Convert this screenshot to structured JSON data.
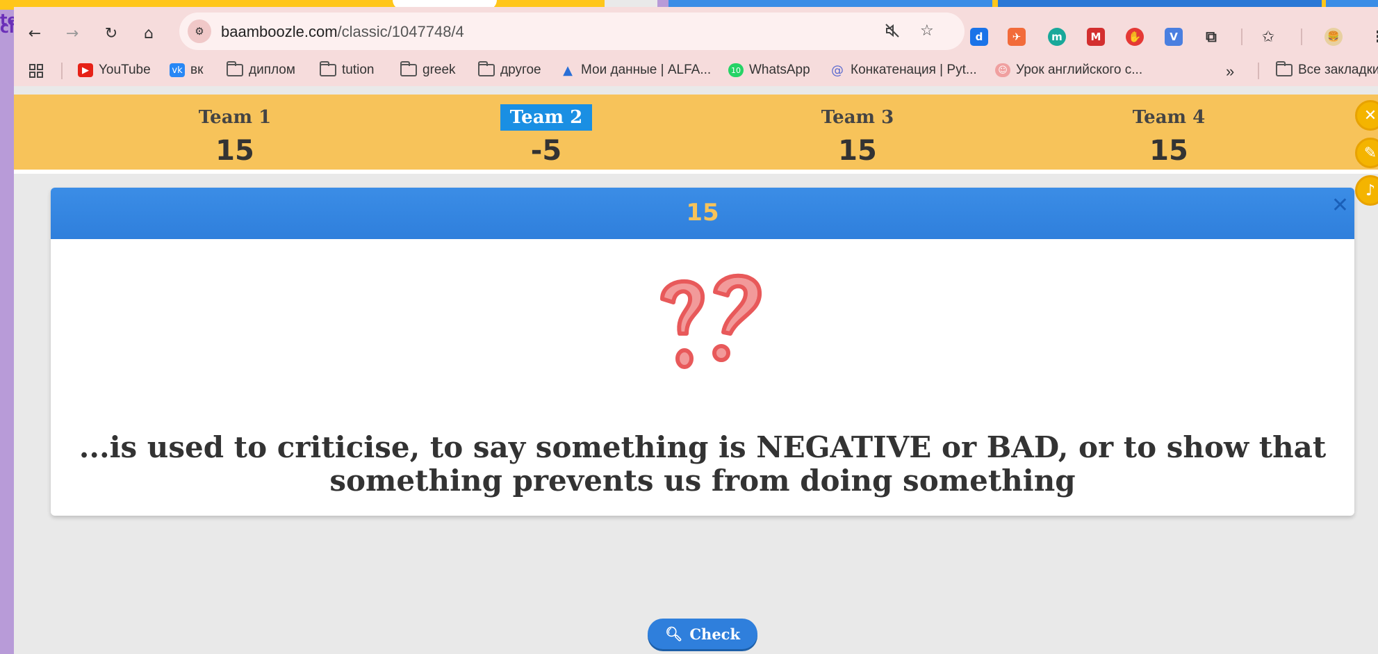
{
  "background_fragments": {
    "left_text_1": "nillion teachers",
    "left_text_2": "cl"
  },
  "browser": {
    "url_domain": "baamboozle.com",
    "url_path": "/classic/1047748/4",
    "bookmarks": [
      {
        "label": "YouTube",
        "icon": "youtube-icon"
      },
      {
        "label": "вк",
        "icon": "vk-icon"
      },
      {
        "label": "диплом",
        "icon": "folder-icon"
      },
      {
        "label": "tution",
        "icon": "folder-icon"
      },
      {
        "label": "greek",
        "icon": "folder-icon"
      },
      {
        "label": "другое",
        "icon": "folder-icon"
      },
      {
        "label": "Мои данные | ALFA...",
        "icon": "alfa-icon"
      },
      {
        "label": "WhatsApp",
        "icon": "whatsapp-icon"
      },
      {
        "label": "Конкатенация | Pyt...",
        "icon": "at-icon"
      },
      {
        "label": "Урок английского с...",
        "icon": "avatar-icon"
      }
    ],
    "all_bookmarks_label": "Все закладки"
  },
  "game": {
    "teams": [
      {
        "name": "Team 1",
        "score": "15",
        "active": false
      },
      {
        "name": "Team 2",
        "score": "-5",
        "active": true
      },
      {
        "name": "Team 3",
        "score": "15",
        "active": false
      },
      {
        "name": "Team 4",
        "score": "15",
        "active": false
      }
    ],
    "card": {
      "points": "15",
      "question": "...is used to criticise, to say something is NEGATIVE or BAD, or to show that something prevents us from doing something"
    },
    "check_label": "Check"
  },
  "colors": {
    "scorebar": "#f7c35a",
    "active_team": "#1a8fe3",
    "card_header": "#2f7fdc",
    "points": "#f7c35a"
  }
}
